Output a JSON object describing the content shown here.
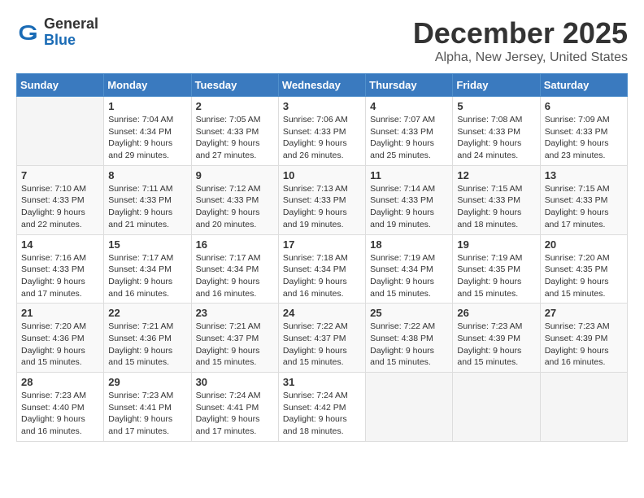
{
  "header": {
    "logo": {
      "general": "General",
      "blue": "Blue"
    },
    "title": "December 2025",
    "location": "Alpha, New Jersey, United States"
  },
  "calendar": {
    "days_of_week": [
      "Sunday",
      "Monday",
      "Tuesday",
      "Wednesday",
      "Thursday",
      "Friday",
      "Saturday"
    ],
    "weeks": [
      [
        {
          "day": "",
          "sunrise": "",
          "sunset": "",
          "daylight": ""
        },
        {
          "day": "1",
          "sunrise": "Sunrise: 7:04 AM",
          "sunset": "Sunset: 4:34 PM",
          "daylight": "Daylight: 9 hours and 29 minutes."
        },
        {
          "day": "2",
          "sunrise": "Sunrise: 7:05 AM",
          "sunset": "Sunset: 4:33 PM",
          "daylight": "Daylight: 9 hours and 27 minutes."
        },
        {
          "day": "3",
          "sunrise": "Sunrise: 7:06 AM",
          "sunset": "Sunset: 4:33 PM",
          "daylight": "Daylight: 9 hours and 26 minutes."
        },
        {
          "day": "4",
          "sunrise": "Sunrise: 7:07 AM",
          "sunset": "Sunset: 4:33 PM",
          "daylight": "Daylight: 9 hours and 25 minutes."
        },
        {
          "day": "5",
          "sunrise": "Sunrise: 7:08 AM",
          "sunset": "Sunset: 4:33 PM",
          "daylight": "Daylight: 9 hours and 24 minutes."
        },
        {
          "day": "6",
          "sunrise": "Sunrise: 7:09 AM",
          "sunset": "Sunset: 4:33 PM",
          "daylight": "Daylight: 9 hours and 23 minutes."
        }
      ],
      [
        {
          "day": "7",
          "sunrise": "Sunrise: 7:10 AM",
          "sunset": "Sunset: 4:33 PM",
          "daylight": "Daylight: 9 hours and 22 minutes."
        },
        {
          "day": "8",
          "sunrise": "Sunrise: 7:11 AM",
          "sunset": "Sunset: 4:33 PM",
          "daylight": "Daylight: 9 hours and 21 minutes."
        },
        {
          "day": "9",
          "sunrise": "Sunrise: 7:12 AM",
          "sunset": "Sunset: 4:33 PM",
          "daylight": "Daylight: 9 hours and 20 minutes."
        },
        {
          "day": "10",
          "sunrise": "Sunrise: 7:13 AM",
          "sunset": "Sunset: 4:33 PM",
          "daylight": "Daylight: 9 hours and 19 minutes."
        },
        {
          "day": "11",
          "sunrise": "Sunrise: 7:14 AM",
          "sunset": "Sunset: 4:33 PM",
          "daylight": "Daylight: 9 hours and 19 minutes."
        },
        {
          "day": "12",
          "sunrise": "Sunrise: 7:15 AM",
          "sunset": "Sunset: 4:33 PM",
          "daylight": "Daylight: 9 hours and 18 minutes."
        },
        {
          "day": "13",
          "sunrise": "Sunrise: 7:15 AM",
          "sunset": "Sunset: 4:33 PM",
          "daylight": "Daylight: 9 hours and 17 minutes."
        }
      ],
      [
        {
          "day": "14",
          "sunrise": "Sunrise: 7:16 AM",
          "sunset": "Sunset: 4:33 PM",
          "daylight": "Daylight: 9 hours and 17 minutes."
        },
        {
          "day": "15",
          "sunrise": "Sunrise: 7:17 AM",
          "sunset": "Sunset: 4:34 PM",
          "daylight": "Daylight: 9 hours and 16 minutes."
        },
        {
          "day": "16",
          "sunrise": "Sunrise: 7:17 AM",
          "sunset": "Sunset: 4:34 PM",
          "daylight": "Daylight: 9 hours and 16 minutes."
        },
        {
          "day": "17",
          "sunrise": "Sunrise: 7:18 AM",
          "sunset": "Sunset: 4:34 PM",
          "daylight": "Daylight: 9 hours and 16 minutes."
        },
        {
          "day": "18",
          "sunrise": "Sunrise: 7:19 AM",
          "sunset": "Sunset: 4:34 PM",
          "daylight": "Daylight: 9 hours and 15 minutes."
        },
        {
          "day": "19",
          "sunrise": "Sunrise: 7:19 AM",
          "sunset": "Sunset: 4:35 PM",
          "daylight": "Daylight: 9 hours and 15 minutes."
        },
        {
          "day": "20",
          "sunrise": "Sunrise: 7:20 AM",
          "sunset": "Sunset: 4:35 PM",
          "daylight": "Daylight: 9 hours and 15 minutes."
        }
      ],
      [
        {
          "day": "21",
          "sunrise": "Sunrise: 7:20 AM",
          "sunset": "Sunset: 4:36 PM",
          "daylight": "Daylight: 9 hours and 15 minutes."
        },
        {
          "day": "22",
          "sunrise": "Sunrise: 7:21 AM",
          "sunset": "Sunset: 4:36 PM",
          "daylight": "Daylight: 9 hours and 15 minutes."
        },
        {
          "day": "23",
          "sunrise": "Sunrise: 7:21 AM",
          "sunset": "Sunset: 4:37 PM",
          "daylight": "Daylight: 9 hours and 15 minutes."
        },
        {
          "day": "24",
          "sunrise": "Sunrise: 7:22 AM",
          "sunset": "Sunset: 4:37 PM",
          "daylight": "Daylight: 9 hours and 15 minutes."
        },
        {
          "day": "25",
          "sunrise": "Sunrise: 7:22 AM",
          "sunset": "Sunset: 4:38 PM",
          "daylight": "Daylight: 9 hours and 15 minutes."
        },
        {
          "day": "26",
          "sunrise": "Sunrise: 7:23 AM",
          "sunset": "Sunset: 4:39 PM",
          "daylight": "Daylight: 9 hours and 15 minutes."
        },
        {
          "day": "27",
          "sunrise": "Sunrise: 7:23 AM",
          "sunset": "Sunset: 4:39 PM",
          "daylight": "Daylight: 9 hours and 16 minutes."
        }
      ],
      [
        {
          "day": "28",
          "sunrise": "Sunrise: 7:23 AM",
          "sunset": "Sunset: 4:40 PM",
          "daylight": "Daylight: 9 hours and 16 minutes."
        },
        {
          "day": "29",
          "sunrise": "Sunrise: 7:23 AM",
          "sunset": "Sunset: 4:41 PM",
          "daylight": "Daylight: 9 hours and 17 minutes."
        },
        {
          "day": "30",
          "sunrise": "Sunrise: 7:24 AM",
          "sunset": "Sunset: 4:41 PM",
          "daylight": "Daylight: 9 hours and 17 minutes."
        },
        {
          "day": "31",
          "sunrise": "Sunrise: 7:24 AM",
          "sunset": "Sunset: 4:42 PM",
          "daylight": "Daylight: 9 hours and 18 minutes."
        },
        {
          "day": "",
          "sunrise": "",
          "sunset": "",
          "daylight": ""
        },
        {
          "day": "",
          "sunrise": "",
          "sunset": "",
          "daylight": ""
        },
        {
          "day": "",
          "sunrise": "",
          "sunset": "",
          "daylight": ""
        }
      ]
    ]
  }
}
